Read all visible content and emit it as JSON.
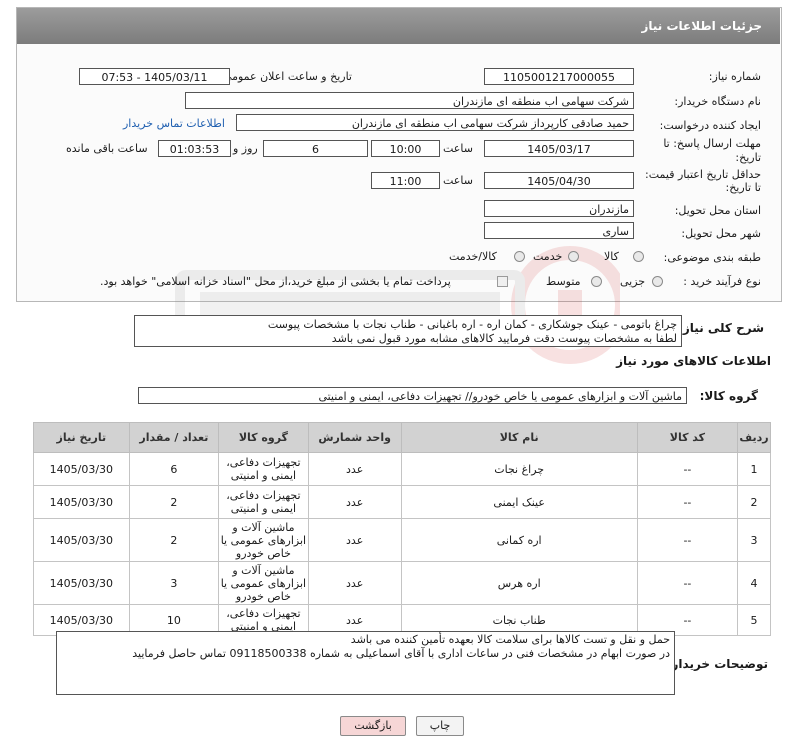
{
  "header": {
    "title": "جزئیات اطلاعات نیاز"
  },
  "form": {
    "need_number_label": "شماره نیاز:",
    "need_number": "1105001217000055",
    "announce_label": "تاریخ و ساعت اعلان عمومی:",
    "announce_value": "1405/03/11 - 07:53",
    "buyer_org_label": "نام دستگاه خریدار:",
    "buyer_org": "شرکت سهامی اب منطقه ای مازندران",
    "requester_label": "ایجاد کننده درخواست:",
    "requester": "حمید  صادقی کارپرداز شرکت سهامی اب منطقه ای مازندران",
    "contact_link": "اطلاعات تماس خریدار",
    "reply_deadline_label_1": "مهلت ارسال پاسخ: تا",
    "reply_deadline_label_2": "تاریخ:",
    "reply_date": "1405/03/17",
    "time_label": "ساعت",
    "reply_time": "10:00",
    "days_value": "6",
    "days_label": "روز و",
    "remaining_time": "01:03:53",
    "remaining_label": "ساعت باقی مانده",
    "price_validity_label_1": "حداقل تاریخ اعتبار قیمت:",
    "price_validity_label_2": "تا تاریخ:",
    "validity_date": "1405/04/30",
    "validity_time": "11:00",
    "province_label": "استان محل تحویل:",
    "province": "مازندران",
    "city_label": "شهر محل تحویل:",
    "city": "ساری",
    "category_label": "طبقه بندی موضوعی:",
    "category_options": [
      "کالا",
      "خدمت",
      "کالا/خدمت"
    ],
    "process_label": "نوع فرآیند خرید :",
    "process_options": [
      "جزیی",
      "متوسط"
    ],
    "payment_note": "پرداخت تمام یا بخشی از مبلغ خرید،از محل \"اسناد خزانه اسلامی\" خواهد بود."
  },
  "description": {
    "label": "شرح کلی نیاز:",
    "text_line1": "چراغ باتومی - عینک جوشکاری - کمان اره - اره باغبانی - طناب نجات با مشخصات پیوست",
    "text_line2": "لطفا به مشخصات پیوست دقت فرمایید کالاهای مشابه مورد قبول نمی باشد"
  },
  "goods_info": {
    "title": "اطلاعات کالاهای مورد نیاز",
    "group_label": "گروه کالا:",
    "group_value": "ماشین آلات و ابزارهای عمومی یا خاص خودرو// تجهیزات دفاعی، ایمنی و امنیتی"
  },
  "table": {
    "headers": [
      "ردیف",
      "کد کالا",
      "نام کالا",
      "واحد شمارش",
      "گروه کالا",
      "تعداد / مقدار",
      "تاریخ نیاز"
    ],
    "rows": [
      [
        "1",
        "--",
        "چراغ نجات",
        "عدد",
        "تجهیزات دفاعی، ایمنی و امنیتی",
        "6",
        "1405/03/30"
      ],
      [
        "2",
        "--",
        "عینک ایمنی",
        "عدد",
        "تجهیزات دفاعی، ایمنی و امنیتی",
        "2",
        "1405/03/30"
      ],
      [
        "3",
        "--",
        "اره کمانی",
        "عدد",
        "ماشین آلات و ابزارهای عمومی یا خاص خودرو",
        "2",
        "1405/03/30"
      ],
      [
        "4",
        "--",
        "اره هرس",
        "عدد",
        "ماشین آلات و ابزارهای عمومی یا خاص خودرو",
        "3",
        "1405/03/30"
      ],
      [
        "5",
        "--",
        "طناب نجات",
        "عدد",
        "تجهیزات دفاعی، ایمنی و امنیتی",
        "10",
        "1405/03/30"
      ]
    ]
  },
  "notes": {
    "label": "توضیحات خریدار:",
    "line1": "حمل و نقل  و تست کالاها برای سلامت کالا بعهده تأمین کننده می باشد",
    "line2": "در صورت ابهام در مشخصات فنی  در ساعات اداری  با آقای اسماعیلی به شماره 09118500338  تماس حاصل فرمایید"
  },
  "buttons": {
    "print": "چاپ",
    "back": "بازگشت"
  },
  "colors": {
    "header_bg": "#8a8a8a",
    "link": "#1f5fb0",
    "back_button": "#f6d6d6"
  }
}
